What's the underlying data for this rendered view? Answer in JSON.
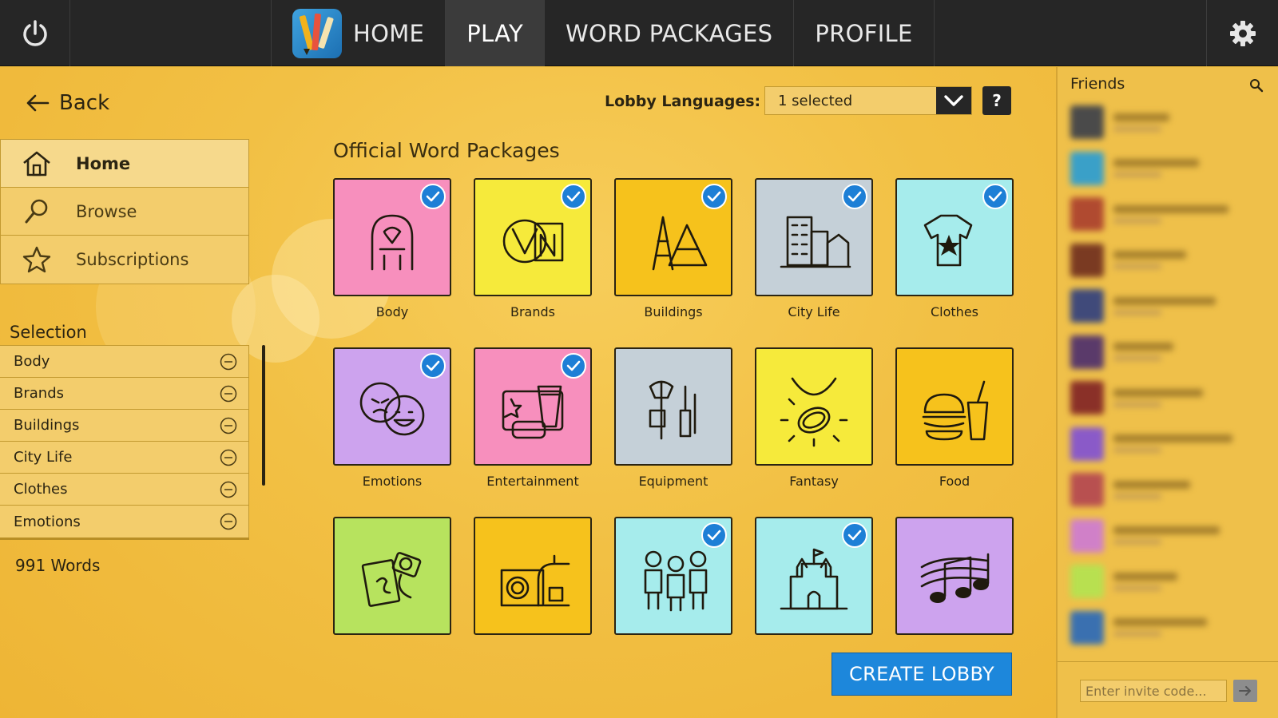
{
  "nav": {
    "items": [
      {
        "label": "HOME"
      },
      {
        "label": "PLAY"
      },
      {
        "label": "WORD PACKAGES"
      },
      {
        "label": "PROFILE"
      }
    ],
    "active": "PLAY"
  },
  "back": {
    "label": "Back"
  },
  "sidenav": {
    "items": [
      {
        "label": "Home",
        "icon": "home-icon"
      },
      {
        "label": "Browse",
        "icon": "search-icon"
      },
      {
        "label": "Subscriptions",
        "icon": "star-icon"
      }
    ]
  },
  "selection": {
    "title": "Selection",
    "items": [
      "Body",
      "Brands",
      "Buildings",
      "City Life",
      "Clothes",
      "Emotions"
    ],
    "word_count": "991 Words"
  },
  "lobby": {
    "languages_label": "Lobby Languages:",
    "languages_value": "1 selected",
    "help": "?"
  },
  "packages": {
    "title": "Official Word Packages",
    "tiles": [
      {
        "label": "Body",
        "color": "#f78fbd",
        "checked": true
      },
      {
        "label": "Brands",
        "color": "#f6ea3b",
        "checked": true
      },
      {
        "label": "Buildings",
        "color": "#f6c21c",
        "checked": true
      },
      {
        "label": "City Life",
        "color": "#c5d0d8",
        "checked": true
      },
      {
        "label": "Clothes",
        "color": "#a6ecec",
        "checked": true
      },
      {
        "label": "Emotions",
        "color": "#cda3ee",
        "checked": true
      },
      {
        "label": "Entertainment",
        "color": "#f78fbd",
        "checked": true
      },
      {
        "label": "Equipment",
        "color": "#c5d0d8",
        "checked": false
      },
      {
        "label": "Fantasy",
        "color": "#f6ea3b",
        "checked": false
      },
      {
        "label": "Food",
        "color": "#f6c21c",
        "checked": false
      },
      {
        "label": "",
        "color": "#b7e35e",
        "checked": false
      },
      {
        "label": "",
        "color": "#f6c21c",
        "checked": false
      },
      {
        "label": "",
        "color": "#a6ecec",
        "checked": true
      },
      {
        "label": "",
        "color": "#a6ecec",
        "checked": true
      },
      {
        "label": "",
        "color": "#cda3ee",
        "checked": false
      }
    ]
  },
  "create_lobby": "CREATE LOBBY",
  "friends": {
    "title": "Friends",
    "invite_placeholder": "Enter invite code..."
  }
}
